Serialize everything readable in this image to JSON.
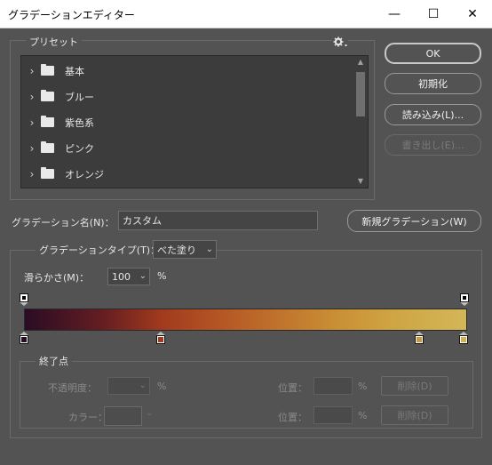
{
  "window": {
    "title": "グラデーションエディター",
    "minimize_glyph": "—",
    "maximize_glyph": "☐",
    "close_glyph": "✕"
  },
  "presets": {
    "label": "プリセット",
    "gear_icon": "gear-icon",
    "items": [
      {
        "label": "基本"
      },
      {
        "label": "ブルー"
      },
      {
        "label": "紫色系"
      },
      {
        "label": "ピンク"
      },
      {
        "label": "オレンジ"
      }
    ]
  },
  "buttons": {
    "ok": "OK",
    "reset": "初期化",
    "load": "読み込み(L)...",
    "export": "書き出し(E)..."
  },
  "name_row": {
    "label": "グラデーション名(N)：",
    "value": "カスタム",
    "new_button": "新規グラデーション(W)"
  },
  "gradient": {
    "type_label": "グラデーションタイプ(T)：",
    "type_value": "べた塗り",
    "smoothness_label": "滑らかさ(M)：",
    "smoothness_value": "100",
    "smoothness_unit": "%",
    "colors": [
      "#2a0c24",
      "#661e22",
      "#a23a1d",
      "#b95e26",
      "#c98e33",
      "#cfa443",
      "#d3b757"
    ],
    "opacity_stops": [
      {
        "location": 0,
        "opacity": 100
      },
      {
        "location": 100,
        "opacity": 100
      }
    ],
    "color_stops": [
      {
        "location": 0,
        "color": "#2a0c24"
      },
      {
        "location": 31,
        "color": "#a23a1d"
      },
      {
        "location": 90,
        "color": "#c89a3a"
      },
      {
        "location": 100,
        "color": "#d3b04c"
      }
    ]
  },
  "stops": {
    "title": "終了点",
    "opacity_label": "不透明度：",
    "opacity_unit": "%",
    "location_label_1": "位置：",
    "location_unit_1": "%",
    "delete_1": "削除(D)",
    "color_label": "カラー：",
    "location_label_2": "位置：",
    "location_unit_2": "%",
    "delete_2": "削除(D)"
  }
}
